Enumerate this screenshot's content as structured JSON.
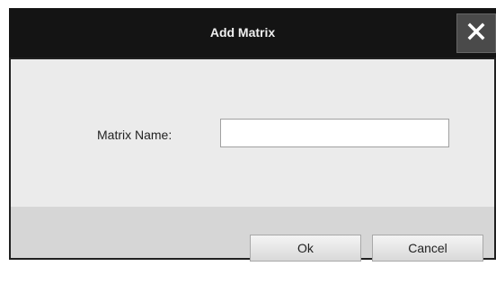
{
  "dialog": {
    "title": "Add Matrix",
    "close_icon": "close-icon",
    "form": {
      "label": "Matrix Name:",
      "value": "",
      "placeholder": ""
    },
    "buttons": {
      "ok": "Ok",
      "cancel": "Cancel"
    }
  }
}
